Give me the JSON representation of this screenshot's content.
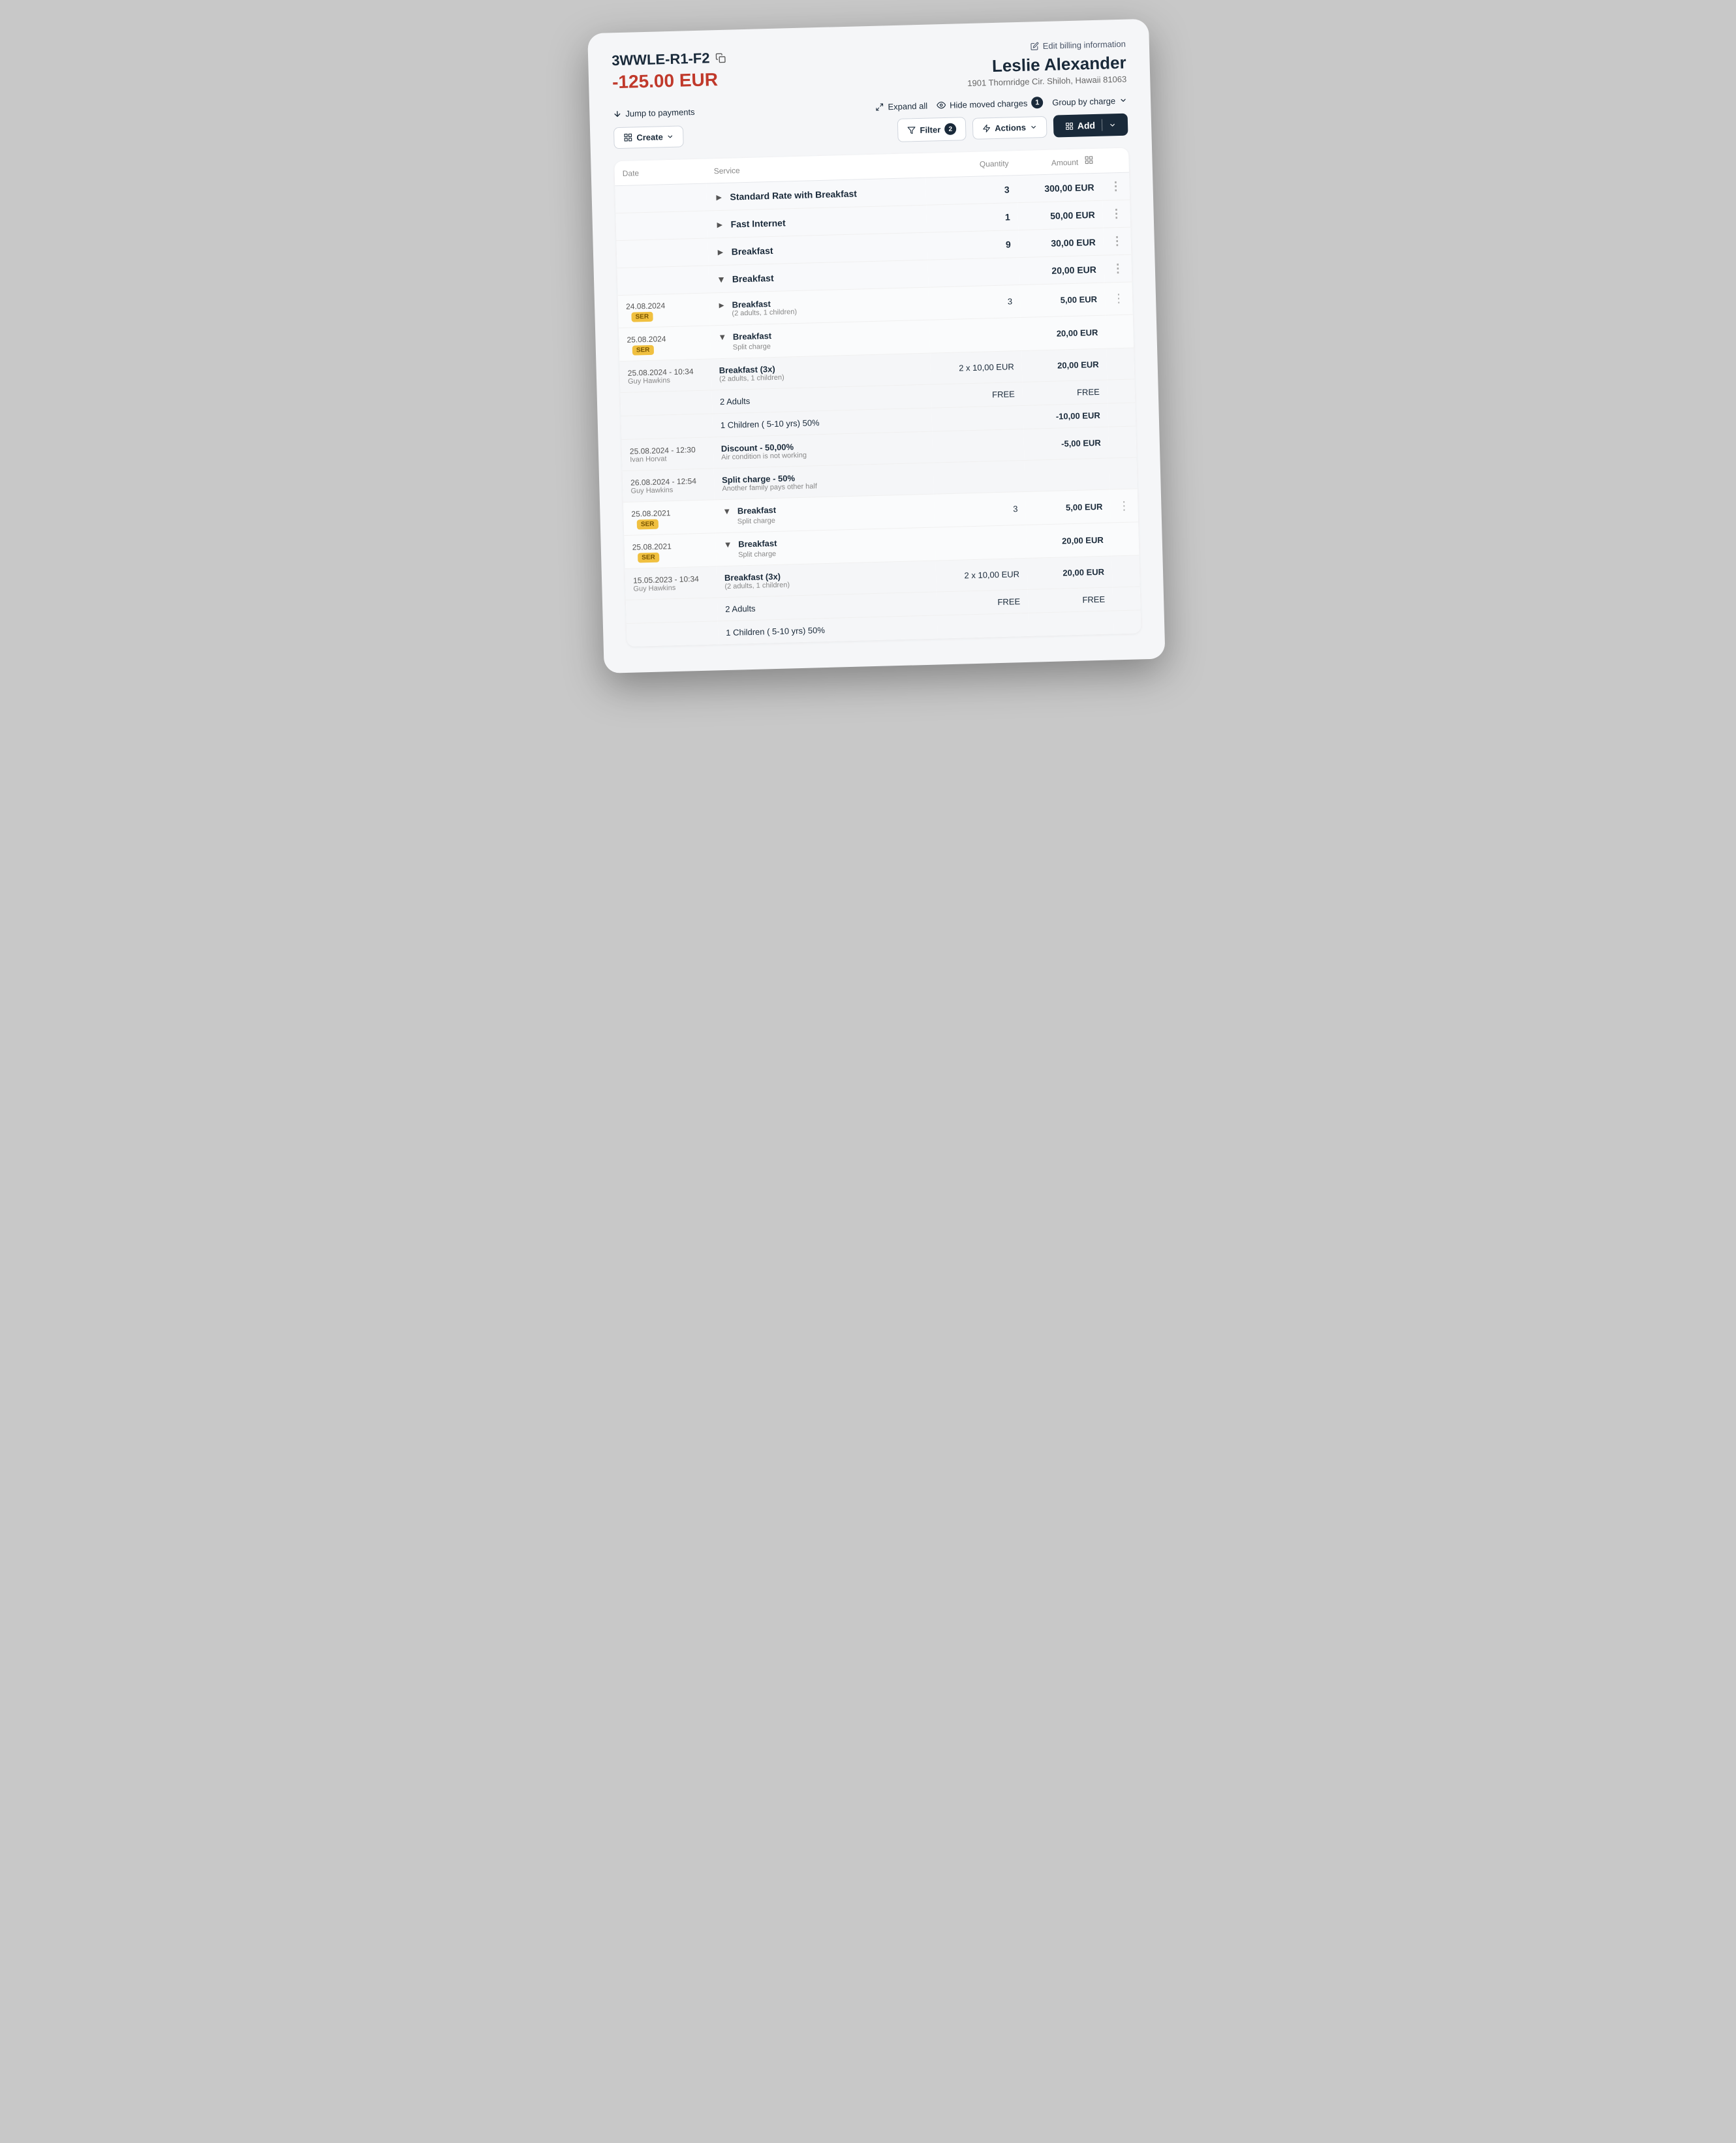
{
  "header": {
    "booking_ref": "3WWLE-R1-F2",
    "amount": "-125.00 EUR",
    "edit_billing_label": "Edit billing information",
    "guest_name": "Leslie Alexander",
    "guest_address": "1901 Thornridge Cir. Shiloh, Hawaii 81063"
  },
  "controls": {
    "jump_label": "Jump to payments",
    "expand_label": "Expand all",
    "hide_moved_label": "Hide moved charges",
    "hide_moved_badge": "1",
    "group_by_label": "Group by charge",
    "create_label": "Create",
    "filter_label": "Filter",
    "filter_badge": "2",
    "actions_label": "Actions",
    "add_label": "Add"
  },
  "table": {
    "col_date": "Date",
    "col_service": "Service",
    "col_quantity": "Quantity",
    "col_amount": "Amount",
    "rows": [
      {
        "type": "group",
        "service": "Standard Rate with Breakfast",
        "quantity": "3",
        "amount": "300,00 EUR",
        "more": true
      },
      {
        "type": "group",
        "service": "Fast Internet",
        "quantity": "1",
        "amount": "50,00 EUR",
        "more": true
      },
      {
        "type": "group",
        "service": "Breakfast",
        "quantity": "9",
        "amount": "30,00 EUR",
        "more": true,
        "expanded": false
      },
      {
        "type": "group_expanded",
        "service": "Breakfast",
        "quantity": "",
        "amount": "20,00 EUR",
        "more": true,
        "expanded": true
      },
      {
        "type": "child",
        "date": "24.08.2024",
        "ser": true,
        "service": "Breakfast",
        "service_sub": "(2 adults, 1 children)",
        "quantity": "3",
        "amount": "5,00 EUR",
        "more": true,
        "collapsed": true
      },
      {
        "type": "child_expanded",
        "date": "25.08.2024",
        "ser": true,
        "service": "Breakfast",
        "service_sub": "Split charge",
        "quantity": "",
        "amount": "20,00 EUR",
        "more": false
      },
      {
        "type": "detail",
        "date": "25.08.2024 - 10:34",
        "person": "Guy Hawkins",
        "service": "Breakfast (3x)",
        "service_sub": "(2 adults, 1 children)",
        "quantity": "2 x 10,00 EUR",
        "amount": "20,00 EUR"
      },
      {
        "type": "detail_line",
        "service": "2 Adults",
        "quantity": "FREE",
        "amount": "FREE"
      },
      {
        "type": "detail_line",
        "service": "1 Children ( 5-10 yrs) 50%",
        "quantity": "",
        "amount": "-10,00 EUR",
        "amount_negative": true
      },
      {
        "type": "detail",
        "date": "25.08.2024 - 12:30",
        "person": "Ivan Horvat",
        "service": "Discount - 50,00%",
        "service_sub": "Air condition is not working",
        "quantity": "",
        "amount": "-5,00 EUR",
        "amount_negative": true
      },
      {
        "type": "detail",
        "date": "26.08.2024 - 12:54",
        "person": "Guy Hawkins",
        "service": "Split charge - 50%",
        "service_sub": "Another family pays other half",
        "quantity": "",
        "amount": "",
        "more": false
      },
      {
        "type": "child_expanded",
        "date": "25.08.2021",
        "ser": true,
        "service": "Breakfast",
        "service_sub": "Split charge",
        "quantity": "3",
        "amount": "5,00 EUR",
        "more": true
      },
      {
        "type": "child_expanded2",
        "date": "25.08.2021",
        "ser": true,
        "service": "Breakfast",
        "service_sub": "Split charge",
        "quantity": "",
        "amount": "20,00 EUR",
        "more": false
      },
      {
        "type": "detail",
        "date": "15.05.2023 - 10:34",
        "person": "Guy Hawkins",
        "service": "Breakfast (3x)",
        "service_sub": "(2 adults, 1 children)",
        "quantity": "2 x 10,00 EUR",
        "amount": "20,00 EUR"
      },
      {
        "type": "detail_line",
        "service": "2 Adults",
        "quantity": "FREE",
        "amount": "FREE"
      },
      {
        "type": "detail_line",
        "service": "1 Children ( 5-10 yrs) 50%",
        "quantity": "",
        "amount": "",
        "amount_negative": false
      }
    ]
  }
}
